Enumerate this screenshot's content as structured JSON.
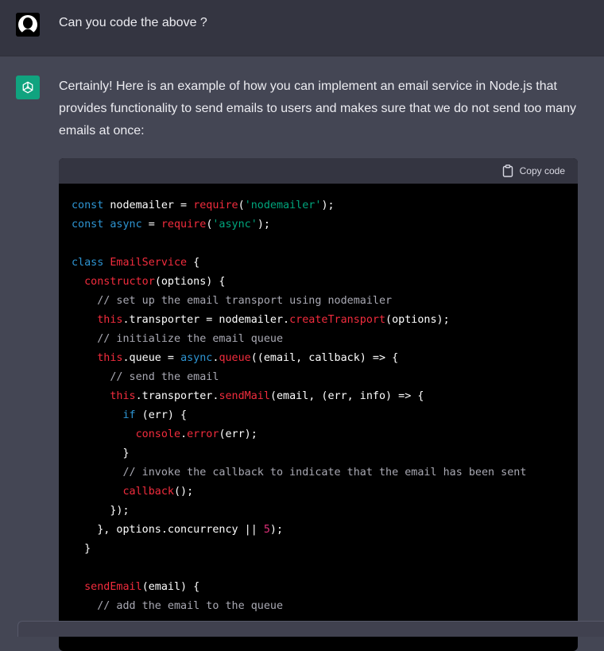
{
  "user_message": {
    "text": "Can you code the above ?"
  },
  "assistant_message": {
    "text": "Certainly! Here is an example of how you can implement an email service in Node.js that provides functionality to send emails to users and makes sure that we do not send too many emails at once:"
  },
  "code_block": {
    "copy_label": "Copy code",
    "lines": [
      [
        {
          "t": "kw",
          "v": "const"
        },
        {
          "t": "plain",
          "v": " nodemailer = "
        },
        {
          "t": "fn",
          "v": "require"
        },
        {
          "t": "plain",
          "v": "("
        },
        {
          "t": "str",
          "v": "'nodemailer'"
        },
        {
          "t": "plain",
          "v": ");"
        }
      ],
      [
        {
          "t": "kw",
          "v": "const"
        },
        {
          "t": "plain",
          "v": " "
        },
        {
          "t": "kw",
          "v": "async"
        },
        {
          "t": "plain",
          "v": " = "
        },
        {
          "t": "fn",
          "v": "require"
        },
        {
          "t": "plain",
          "v": "("
        },
        {
          "t": "str",
          "v": "'async'"
        },
        {
          "t": "plain",
          "v": ");"
        }
      ],
      [],
      [
        {
          "t": "kw",
          "v": "class"
        },
        {
          "t": "plain",
          "v": " "
        },
        {
          "t": "fn",
          "v": "EmailService"
        },
        {
          "t": "plain",
          "v": " {"
        }
      ],
      [
        {
          "t": "plain",
          "v": "  "
        },
        {
          "t": "fn",
          "v": "constructor"
        },
        {
          "t": "plain",
          "v": "(options) {"
        }
      ],
      [
        {
          "t": "plain",
          "v": "    "
        },
        {
          "t": "cm",
          "v": "// set up the email transport using nodemailer"
        }
      ],
      [
        {
          "t": "plain",
          "v": "    "
        },
        {
          "t": "fn",
          "v": "this"
        },
        {
          "t": "plain",
          "v": ".transporter = nodemailer."
        },
        {
          "t": "fn",
          "v": "createTransport"
        },
        {
          "t": "plain",
          "v": "(options);"
        }
      ],
      [
        {
          "t": "plain",
          "v": "    "
        },
        {
          "t": "cm",
          "v": "// initialize the email queue"
        }
      ],
      [
        {
          "t": "plain",
          "v": "    "
        },
        {
          "t": "fn",
          "v": "this"
        },
        {
          "t": "plain",
          "v": ".queue = "
        },
        {
          "t": "kw",
          "v": "async"
        },
        {
          "t": "plain",
          "v": "."
        },
        {
          "t": "fn",
          "v": "queue"
        },
        {
          "t": "plain",
          "v": "((email, callback) => {"
        }
      ],
      [
        {
          "t": "plain",
          "v": "      "
        },
        {
          "t": "cm",
          "v": "// send the email"
        }
      ],
      [
        {
          "t": "plain",
          "v": "      "
        },
        {
          "t": "fn",
          "v": "this"
        },
        {
          "t": "plain",
          "v": ".transporter."
        },
        {
          "t": "fn",
          "v": "sendMail"
        },
        {
          "t": "plain",
          "v": "(email, (err, info) => {"
        }
      ],
      [
        {
          "t": "plain",
          "v": "        "
        },
        {
          "t": "kw",
          "v": "if"
        },
        {
          "t": "plain",
          "v": " (err) {"
        }
      ],
      [
        {
          "t": "plain",
          "v": "          "
        },
        {
          "t": "fn",
          "v": "console"
        },
        {
          "t": "plain",
          "v": "."
        },
        {
          "t": "fn",
          "v": "error"
        },
        {
          "t": "plain",
          "v": "(err);"
        }
      ],
      [
        {
          "t": "plain",
          "v": "        }"
        }
      ],
      [
        {
          "t": "plain",
          "v": "        "
        },
        {
          "t": "cm",
          "v": "// invoke the callback to indicate that the email has been sent"
        }
      ],
      [
        {
          "t": "plain",
          "v": "        "
        },
        {
          "t": "fn",
          "v": "callback"
        },
        {
          "t": "plain",
          "v": "();"
        }
      ],
      [
        {
          "t": "plain",
          "v": "      });"
        }
      ],
      [
        {
          "t": "plain",
          "v": "    }, options.concurrency || "
        },
        {
          "t": "num",
          "v": "5"
        },
        {
          "t": "plain",
          "v": ");"
        }
      ],
      [
        {
          "t": "plain",
          "v": "  }"
        }
      ],
      [],
      [
        {
          "t": "plain",
          "v": "  "
        },
        {
          "t": "fn",
          "v": "sendEmail"
        },
        {
          "t": "plain",
          "v": "(email) {"
        }
      ],
      [
        {
          "t": "plain",
          "v": "    "
        },
        {
          "t": "cm",
          "v": "// add the email to the queue"
        }
      ]
    ]
  }
}
